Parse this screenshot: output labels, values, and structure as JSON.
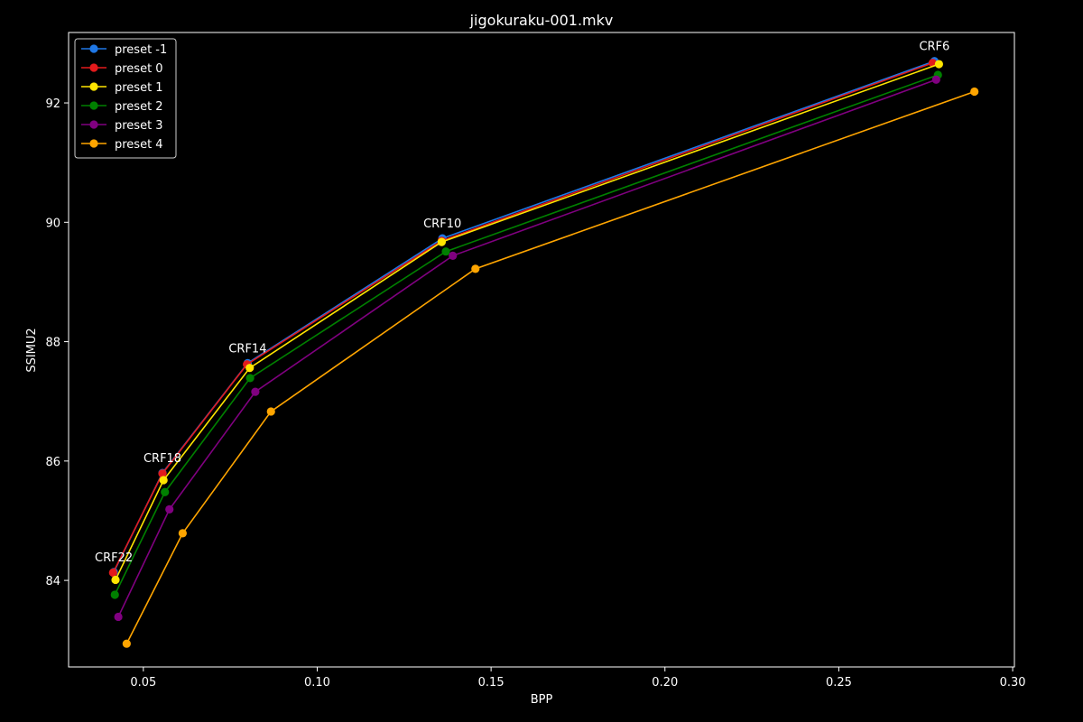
{
  "chart_data": {
    "type": "line",
    "title": "jigokuraku-001.mkv",
    "xlabel": "BPP",
    "ylabel": "SSIMU2",
    "xlim": [
      0.0285,
      0.3005
    ],
    "ylim": [
      82.55,
      93.18
    ],
    "xticks": [
      0.05,
      0.1,
      0.15,
      0.2,
      0.25,
      0.3
    ],
    "xtick_labels": [
      "0.05",
      "0.10",
      "0.15",
      "0.20",
      "0.25",
      "0.30"
    ],
    "yticks": [
      84,
      86,
      88,
      90,
      92
    ],
    "ytick_labels": [
      "84",
      "86",
      "88",
      "90",
      "92"
    ],
    "grid": false,
    "legend_position": "top-left",
    "background_color": "#000000",
    "axis_color": "#ffffff",
    "series": [
      {
        "name": "preset -1",
        "color": "#1f77e5",
        "points": [
          {
            "x": 0.0415,
            "y": 84.14
          },
          {
            "x": 0.0555,
            "y": 85.8
          },
          {
            "x": 0.08,
            "y": 87.64
          },
          {
            "x": 0.136,
            "y": 89.73
          },
          {
            "x": 0.2775,
            "y": 92.7
          }
        ]
      },
      {
        "name": "preset 0",
        "color": "#e31a1c",
        "points": [
          {
            "x": 0.0413,
            "y": 84.13
          },
          {
            "x": 0.0555,
            "y": 85.79
          },
          {
            "x": 0.0798,
            "y": 87.62
          },
          {
            "x": 0.1358,
            "y": 89.69
          },
          {
            "x": 0.277,
            "y": 92.67
          }
        ]
      },
      {
        "name": "preset 1",
        "color": "#ffe500",
        "points": [
          {
            "x": 0.042,
            "y": 84.01
          },
          {
            "x": 0.0558,
            "y": 85.68
          },
          {
            "x": 0.0806,
            "y": 87.56
          },
          {
            "x": 0.1358,
            "y": 89.67
          },
          {
            "x": 0.2788,
            "y": 92.65
          }
        ]
      },
      {
        "name": "preset 2",
        "color": "#008000",
        "points": [
          {
            "x": 0.0418,
            "y": 83.76
          },
          {
            "x": 0.0562,
            "y": 85.48
          },
          {
            "x": 0.0807,
            "y": 87.39
          },
          {
            "x": 0.137,
            "y": 89.51
          },
          {
            "x": 0.2785,
            "y": 92.47
          }
        ]
      },
      {
        "name": "preset 3",
        "color": "#800080",
        "points": [
          {
            "x": 0.0428,
            "y": 83.39
          },
          {
            "x": 0.0575,
            "y": 85.19
          },
          {
            "x": 0.0822,
            "y": 87.16
          },
          {
            "x": 0.139,
            "y": 89.44
          },
          {
            "x": 0.278,
            "y": 92.39
          }
        ]
      },
      {
        "name": "preset 4",
        "color": "#ffa500",
        "points": [
          {
            "x": 0.0452,
            "y": 82.94
          },
          {
            "x": 0.0613,
            "y": 84.79
          },
          {
            "x": 0.0867,
            "y": 86.83
          },
          {
            "x": 0.1455,
            "y": 89.22
          },
          {
            "x": 0.289,
            "y": 92.19
          }
        ]
      }
    ],
    "annotations": [
      {
        "text": "CRF22",
        "x": 0.0415,
        "y": 84.14
      },
      {
        "text": "CRF18",
        "x": 0.0555,
        "y": 85.8
      },
      {
        "text": "CRF14",
        "x": 0.08,
        "y": 87.64
      },
      {
        "text": "CRF10",
        "x": 0.136,
        "y": 89.73
      },
      {
        "text": "CRF6",
        "x": 0.2775,
        "y": 92.7
      }
    ]
  }
}
